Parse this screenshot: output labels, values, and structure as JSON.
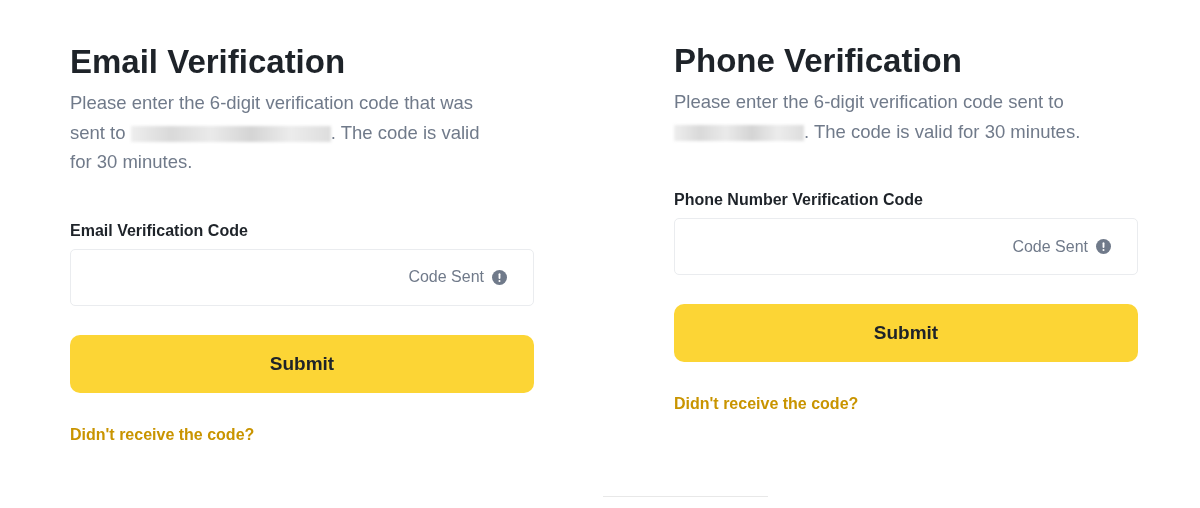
{
  "panels": [
    {
      "title": "Email Verification",
      "description_before": "Please enter the 6-digit verification code that was sent to",
      "description_after": ". The code is valid for 30 minutes.",
      "field": {
        "label": "Email Verification Code",
        "status": "Code Sent"
      },
      "button": "Submit",
      "link": "Didn't receive the code?"
    },
    {
      "title": "Phone Verification",
      "description_before": "Please enter the 6-digit verification code sent to",
      "description_after": ". The code is valid for 30 minutes.",
      "field": {
        "label": "Phone Number Verification Code",
        "status": "Code Sent"
      },
      "button": "Submit",
      "link": "Didn't receive the code?"
    }
  ]
}
